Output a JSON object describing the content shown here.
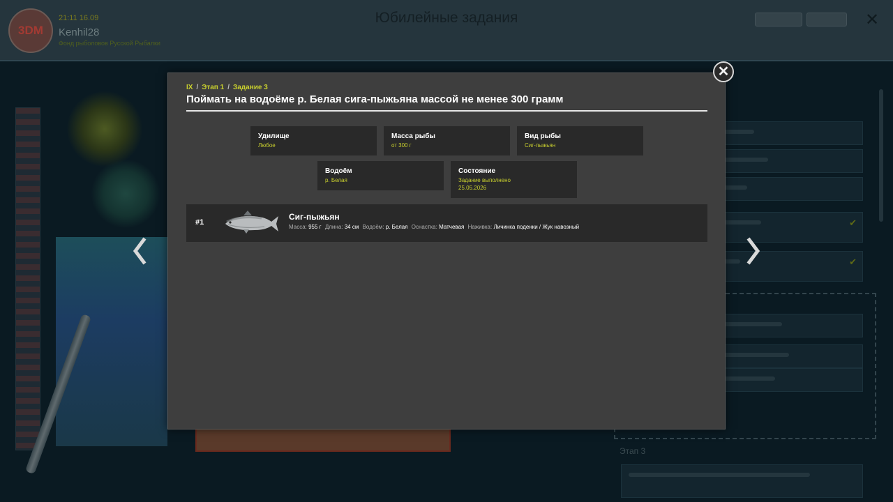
{
  "background": {
    "time": "21:11 16.09",
    "username": "Kenhil28",
    "user_subtitle": "Фонд рыболовов Русской Рыбалки",
    "title": "Юбилейные задания",
    "avatar_text": "3DM",
    "stage3_label": "Этап 3"
  },
  "modal": {
    "breadcrumb": [
      "IX",
      "Этап 1",
      "Задание 3"
    ],
    "title": "Поймать на водоёме р. Белая сига-пыжьяна массой не менее 300 грамм",
    "info": {
      "rod": {
        "label": "Удилище",
        "value": "Любое"
      },
      "fish_mass": {
        "label": "Масса рыбы",
        "value": "от 300 г"
      },
      "fish_type": {
        "label": "Вид рыбы",
        "value": "Сиг-пыжьян"
      },
      "water": {
        "label": "Водоём",
        "value": "р. Белая"
      },
      "status": {
        "label": "Состояние",
        "value": "Задание выполнено",
        "date": "25.05.2026"
      }
    },
    "catch": {
      "rank": "#1",
      "fish_name": "Сиг-пыжьян",
      "mass_label": "Масса:",
      "mass": "955 г",
      "length_label": "Длина:",
      "length": "34 см",
      "water_label": "Водоём:",
      "water": "р. Белая",
      "tackle_label": "Оснастка:",
      "tackle": "Матчевая",
      "bait_label": "Наживка:",
      "bait": "Личинка поденки / Жук навозный"
    }
  },
  "colors": {
    "accent": "#c8cf2e",
    "panel": "#3e3e3e",
    "box": "#292929"
  },
  "icons": {
    "close": "close-icon",
    "prev": "chevron-left-icon",
    "next": "chevron-right-icon"
  }
}
